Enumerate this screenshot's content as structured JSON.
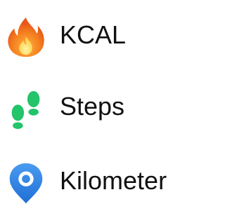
{
  "metrics": [
    {
      "label": "KCAL",
      "icon": "flame-icon",
      "color": "#F07A1E"
    },
    {
      "label": "Steps",
      "icon": "footsteps-icon",
      "color": "#23C46A"
    },
    {
      "label": "Kilometer",
      "icon": "location-pin-icon",
      "color": "#2F7FE0"
    }
  ]
}
